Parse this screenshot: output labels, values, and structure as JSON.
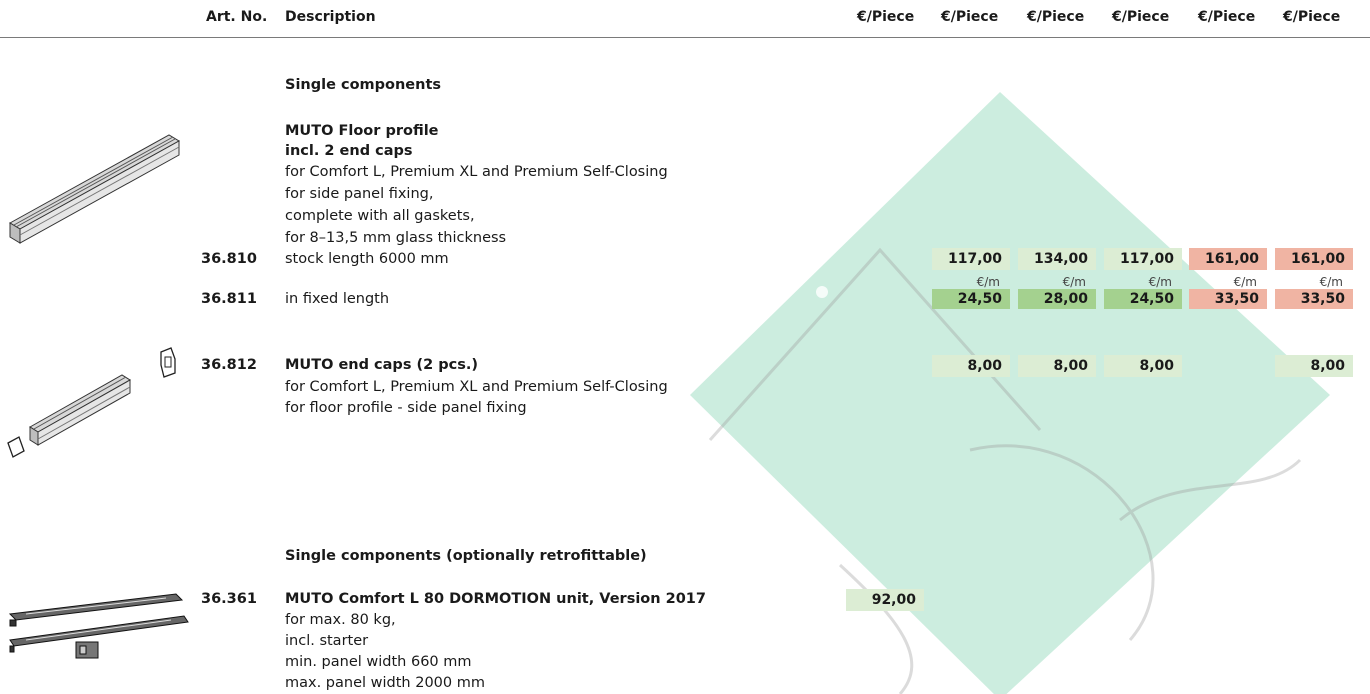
{
  "header": {
    "art_no": "Art. No.",
    "description": "Description",
    "price_cols": [
      "€/Piece",
      "€/Piece",
      "€/Piece",
      "€/Piece",
      "€/Piece",
      "€/Piece"
    ]
  },
  "sections": {
    "single": "Single components",
    "retro": "Single components (optionally retrofittable)"
  },
  "floor_profile": {
    "title1": "MUTO Floor profile",
    "title2": "incl. 2 end caps",
    "desc": [
      "for Comfort L, Premium XL and Premium Self-Closing",
      "for side panel fixing,",
      "complete with all gaskets,",
      "for 8–13,5 mm glass thickness"
    ],
    "stock_art": "36.810",
    "stock_desc": "stock length 6000 mm",
    "stock_prices": [
      "117,00",
      "134,00",
      "117,00",
      "161,00",
      "161,00"
    ],
    "unit": "€/m",
    "fixed_art": "36.811",
    "fixed_desc": "in fixed length",
    "fixed_prices": [
      "24,50",
      "28,00",
      "24,50",
      "33,50",
      "33,50"
    ]
  },
  "end_caps": {
    "art": "36.812",
    "title": "MUTO end caps (2 pcs.)",
    "desc": [
      "for Comfort L, Premium XL and Premium Self-Closing",
      "for floor profile - side panel fixing"
    ],
    "prices": [
      "8,00",
      "8,00",
      "8,00",
      "8,00"
    ]
  },
  "dormotion": {
    "art": "36.361",
    "title": "MUTO Comfort L 80 DORMOTION unit, Version 2017",
    "desc": [
      "for max. 80 kg,",
      "incl. starter",
      "min. panel width 660 mm",
      "max. panel width 2000 mm"
    ],
    "price": "92,00"
  },
  "colors": {
    "green_light": "#dcedd4",
    "green_dark": "#a4d18f",
    "red": "#f0b4a3",
    "watermark": "#7fcfae"
  }
}
